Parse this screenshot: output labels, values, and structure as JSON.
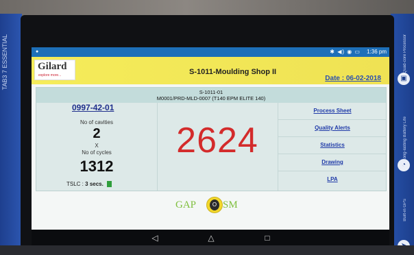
{
  "device": {
    "case_left_text": "TAB3 7 ESSENTIAL",
    "case_right_features": [
      "Quad-core Processor",
      "Long-lasting Battery Life",
      "Built-in GPS"
    ]
  },
  "statusbar": {
    "time": "1:36 pm",
    "icons": "✱ ◀) ◉ ▭"
  },
  "header": {
    "logo_name": "Gilard",
    "logo_tagline": "explore more...",
    "title": "S-1011-Moulding Shop II",
    "date": "Date : 06-02-2018"
  },
  "sub_header": {
    "line1": "S-1011-01",
    "line2": "M0001/PRD-MLD-0007 (T140 EPM ELITE 140)"
  },
  "left": {
    "part_number": "0997-42-01",
    "cavities_label": "No of cavities",
    "cavities_value": "2",
    "times": "X",
    "cycles_label": "No of cycles",
    "cycles_value": "1312",
    "tslc_label": "TSLC :",
    "tslc_value": "3 secs."
  },
  "counter": "2624",
  "links": [
    "Process Sheet",
    "Quality Alerts",
    "Statistics",
    "Drawing",
    "LPA"
  ],
  "footer_logo": {
    "left": "GAP",
    "center": "O",
    "right": "SM"
  },
  "colors": {
    "header_bg": "#f5ec5a",
    "counter": "#d32b2b",
    "link": "#1f3aa8",
    "status_ok": "#2f9e3b"
  },
  "nav": {
    "back": "◁",
    "home": "△",
    "recents": "□"
  }
}
